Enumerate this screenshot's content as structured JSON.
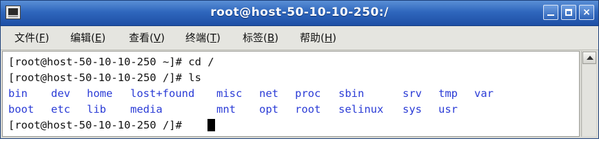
{
  "window": {
    "title": "root@host-50-10-10-250:/",
    "controls": {
      "minimize": "",
      "maximize": "",
      "close": "×"
    }
  },
  "menu": [
    {
      "before": "文件(",
      "key": "F",
      "after": ")"
    },
    {
      "before": "编辑(",
      "key": "E",
      "after": ")"
    },
    {
      "before": "查看(",
      "key": "V",
      "after": ")"
    },
    {
      "before": "终端(",
      "key": "T",
      "after": ")"
    },
    {
      "before": "标签(",
      "key": "B",
      "after": ")"
    },
    {
      "before": "帮助(",
      "key": "H",
      "after": ")"
    }
  ],
  "terminal": {
    "lines": [
      "[root@host-50-10-10-250 ~]# cd /",
      "[root@host-50-10-10-250 /]# ls"
    ],
    "ls_rows": [
      [
        "bin",
        "dev",
        "home",
        "lost+found",
        "misc",
        "net",
        "proc",
        "sbin",
        "srv",
        "tmp",
        "var"
      ],
      [
        "boot",
        "etc",
        "lib",
        "media",
        "mnt",
        "opt",
        "root",
        "selinux",
        "sys",
        "usr"
      ]
    ],
    "prompt": "[root@host-50-10-10-250 /]# ",
    "colors": {
      "text": "#111111",
      "directory": "#2a3bd6",
      "cursor": "#000000"
    }
  }
}
